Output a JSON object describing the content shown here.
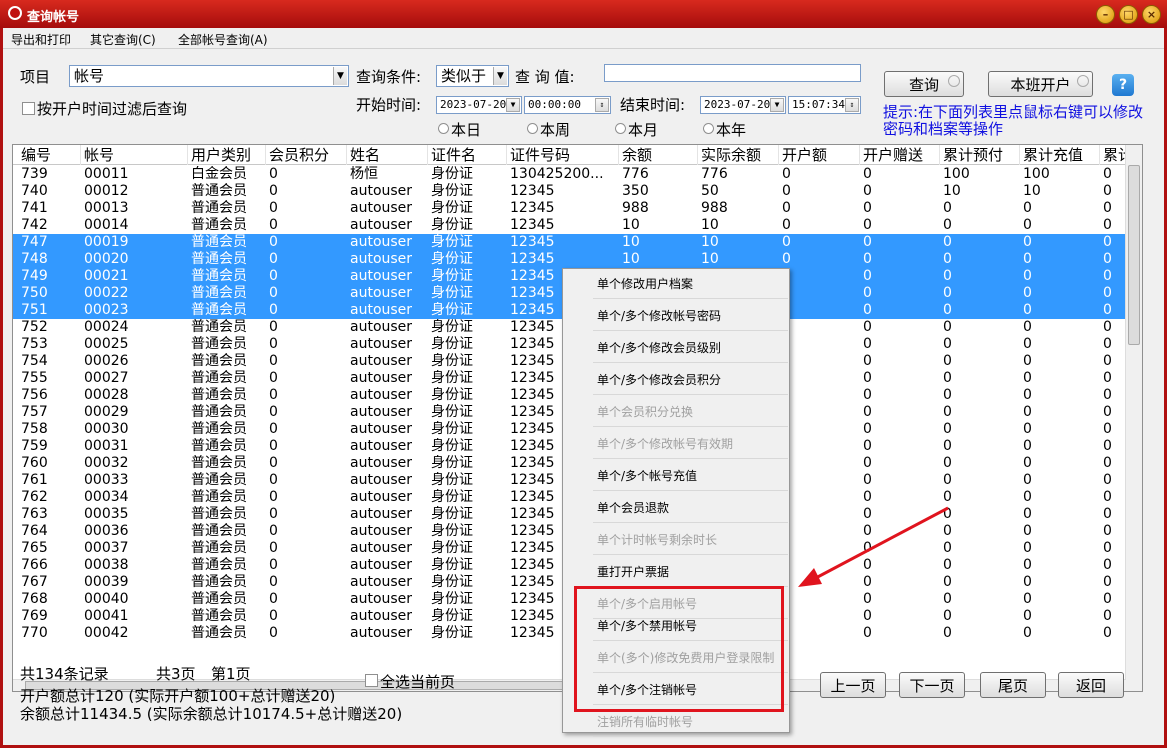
{
  "window": {
    "title": "查询帐号"
  },
  "menu": [
    "导出和打印",
    "其它查询(C)",
    "全部帐号查询(A)"
  ],
  "form": {
    "item_label": "项目",
    "item_value": "帐号",
    "condition_label": "查询条件:",
    "condition_value": "类似于",
    "query_value_label": "查 询 值:",
    "query_value": "",
    "filter_by_time_label": "按开户时间过滤后查询",
    "start_label": "开始时间:",
    "start_date": "2023-07-20",
    "start_time": "00:00:00",
    "end_label": "结束时间:",
    "end_date": "2023-07-20",
    "end_time": "15:07:34",
    "range_options": [
      "本日",
      "本周",
      "本月",
      "本年"
    ],
    "query_button": "查询",
    "shift_open_button": "本班开户",
    "hint": "提示:在下面列表里点鼠标右键可以修改密码和档案等操作"
  },
  "table": {
    "columns": [
      "编号",
      "帐号",
      "用户类别",
      "会员积分",
      "姓名",
      "证件名",
      "证件号码",
      "余额",
      "实际余额",
      "开户额",
      "开户赠送",
      "累计预付",
      "累计充值",
      "累计"
    ],
    "rows": [
      {
        "cells": [
          "739",
          "00011",
          "白金会员",
          "0",
          "杨恒",
          "身份证",
          "130425200...",
          "776",
          "776",
          "0",
          "0",
          "100",
          "100",
          "0"
        ],
        "selected": false
      },
      {
        "cells": [
          "740",
          "00012",
          "普通会员",
          "0",
          "autouser",
          "身份证",
          "12345",
          "350",
          "50",
          "0",
          "0",
          "10",
          "10",
          "0"
        ],
        "selected": false
      },
      {
        "cells": [
          "741",
          "00013",
          "普通会员",
          "0",
          "autouser",
          "身份证",
          "12345",
          "988",
          "988",
          "0",
          "0",
          "0",
          "0",
          "0"
        ],
        "selected": false
      },
      {
        "cells": [
          "742",
          "00014",
          "普通会员",
          "0",
          "autouser",
          "身份证",
          "12345",
          "10",
          "10",
          "0",
          "0",
          "0",
          "0",
          "0"
        ],
        "selected": false
      },
      {
        "cells": [
          "747",
          "00019",
          "普通会员",
          "0",
          "autouser",
          "身份证",
          "12345",
          "10",
          "10",
          "0",
          "0",
          "0",
          "0",
          "0"
        ],
        "selected": true
      },
      {
        "cells": [
          "748",
          "00020",
          "普通会员",
          "0",
          "autouser",
          "身份证",
          "12345",
          "10",
          "10",
          "0",
          "0",
          "0",
          "0",
          "0"
        ],
        "selected": true
      },
      {
        "cells": [
          "749",
          "00021",
          "普通会员",
          "0",
          "autouser",
          "身份证",
          "12345",
          "",
          "",
          "",
          "0",
          "0",
          "0",
          "0"
        ],
        "selected": true
      },
      {
        "cells": [
          "750",
          "00022",
          "普通会员",
          "0",
          "autouser",
          "身份证",
          "12345",
          "",
          "",
          "",
          "0",
          "0",
          "0",
          "0"
        ],
        "selected": true
      },
      {
        "cells": [
          "751",
          "00023",
          "普通会员",
          "0",
          "autouser",
          "身份证",
          "12345",
          "",
          "",
          "",
          "0",
          "0",
          "0",
          "0"
        ],
        "selected": true
      },
      {
        "cells": [
          "752",
          "00024",
          "普通会员",
          "0",
          "autouser",
          "身份证",
          "12345",
          "",
          "",
          "",
          "0",
          "0",
          "0",
          "0"
        ],
        "selected": false
      },
      {
        "cells": [
          "753",
          "00025",
          "普通会员",
          "0",
          "autouser",
          "身份证",
          "12345",
          "",
          "",
          "",
          "0",
          "0",
          "0",
          "0"
        ],
        "selected": false
      },
      {
        "cells": [
          "754",
          "00026",
          "普通会员",
          "0",
          "autouser",
          "身份证",
          "12345",
          "",
          "",
          "",
          "0",
          "0",
          "0",
          "0"
        ],
        "selected": false
      },
      {
        "cells": [
          "755",
          "00027",
          "普通会员",
          "0",
          "autouser",
          "身份证",
          "12345",
          "",
          "",
          "",
          "0",
          "0",
          "0",
          "0"
        ],
        "selected": false
      },
      {
        "cells": [
          "756",
          "00028",
          "普通会员",
          "0",
          "autouser",
          "身份证",
          "12345",
          "",
          "",
          "",
          "0",
          "0",
          "0",
          "0"
        ],
        "selected": false
      },
      {
        "cells": [
          "757",
          "00029",
          "普通会员",
          "0",
          "autouser",
          "身份证",
          "12345",
          "",
          "",
          "",
          "0",
          "0",
          "0",
          "0"
        ],
        "selected": false
      },
      {
        "cells": [
          "758",
          "00030",
          "普通会员",
          "0",
          "autouser",
          "身份证",
          "12345",
          "",
          "",
          "",
          "0",
          "0",
          "0",
          "0"
        ],
        "selected": false
      },
      {
        "cells": [
          "759",
          "00031",
          "普通会员",
          "0",
          "autouser",
          "身份证",
          "12345",
          "",
          "",
          "",
          "0",
          "0",
          "0",
          "0"
        ],
        "selected": false
      },
      {
        "cells": [
          "760",
          "00032",
          "普通会员",
          "0",
          "autouser",
          "身份证",
          "12345",
          "",
          "",
          "",
          "0",
          "0",
          "0",
          "0"
        ],
        "selected": false
      },
      {
        "cells": [
          "761",
          "00033",
          "普通会员",
          "0",
          "autouser",
          "身份证",
          "12345",
          "",
          "",
          "",
          "0",
          "0",
          "0",
          "0"
        ],
        "selected": false
      },
      {
        "cells": [
          "762",
          "00034",
          "普通会员",
          "0",
          "autouser",
          "身份证",
          "12345",
          "",
          "",
          "",
          "0",
          "0",
          "0",
          "0"
        ],
        "selected": false
      },
      {
        "cells": [
          "763",
          "00035",
          "普通会员",
          "0",
          "autouser",
          "身份证",
          "12345",
          "",
          "",
          "",
          "0",
          "0",
          "0",
          "0"
        ],
        "selected": false
      },
      {
        "cells": [
          "764",
          "00036",
          "普通会员",
          "0",
          "autouser",
          "身份证",
          "12345",
          "",
          "",
          "",
          "0",
          "0",
          "0",
          "0"
        ],
        "selected": false
      },
      {
        "cells": [
          "765",
          "00037",
          "普通会员",
          "0",
          "autouser",
          "身份证",
          "12345",
          "",
          "",
          "",
          "0",
          "0",
          "0",
          "0"
        ],
        "selected": false
      },
      {
        "cells": [
          "766",
          "00038",
          "普通会员",
          "0",
          "autouser",
          "身份证",
          "12345",
          "",
          "",
          "",
          "0",
          "0",
          "0",
          "0"
        ],
        "selected": false
      },
      {
        "cells": [
          "767",
          "00039",
          "普通会员",
          "0",
          "autouser",
          "身份证",
          "12345",
          "",
          "",
          "",
          "0",
          "0",
          "0",
          "0"
        ],
        "selected": false
      },
      {
        "cells": [
          "768",
          "00040",
          "普通会员",
          "0",
          "autouser",
          "身份证",
          "12345",
          "",
          "",
          "",
          "0",
          "0",
          "0",
          "0"
        ],
        "selected": false
      },
      {
        "cells": [
          "769",
          "00041",
          "普通会员",
          "0",
          "autouser",
          "身份证",
          "12345",
          "",
          "",
          "",
          "0",
          "0",
          "0",
          "0"
        ],
        "selected": false
      },
      {
        "cells": [
          "770",
          "00042",
          "普通会员",
          "0",
          "autouser",
          "身份证",
          "12345",
          "",
          "",
          "",
          "0",
          "0",
          "0",
          "0"
        ],
        "selected": false
      }
    ]
  },
  "context_menu": {
    "items": [
      {
        "label": "单个修改用户档案",
        "enabled": true
      },
      {
        "label": "单个/多个修改帐号密码",
        "enabled": true
      },
      {
        "label": "单个/多个修改会员级别",
        "enabled": true
      },
      {
        "label": "单个/多个修改会员积分",
        "enabled": true
      },
      {
        "label": "单个会员积分兑换",
        "enabled": false
      },
      {
        "label": "单个/多个修改帐号有效期",
        "enabled": false
      },
      {
        "label": "单个/多个帐号充值",
        "enabled": true
      },
      {
        "label": "单个会员退款",
        "enabled": true
      },
      {
        "label": "单个计时帐号剩余时长",
        "enabled": false
      },
      {
        "label": "重打开户票据",
        "enabled": true
      },
      {
        "label": "单个/多个启用帐号",
        "enabled": false
      },
      {
        "label": "单个/多个禁用帐号",
        "enabled": true
      },
      {
        "label": "单个(多个)修改免费用户登录限制",
        "enabled": false
      },
      {
        "label": "单个/多个注销帐号",
        "enabled": true
      },
      {
        "label": "注销所有临时帐号",
        "enabled": false
      }
    ]
  },
  "footer": {
    "total_records": "共134条记录",
    "total_pages": "共3页",
    "current_page": "第1页",
    "select_all_label": "全选当前页",
    "open_amount_summary": "开户额总计120 (实际开户额100+总计赠送20)",
    "balance_summary": "余额总计11434.5 (实际余额总计10174.5+总计赠送20)",
    "prev_button": "上一页",
    "next_button": "下一页",
    "last_button": "尾页",
    "back_button": "返回"
  },
  "colors": {
    "titlebar": "#c41a14",
    "selection": "#3399ff",
    "hint_text": "#1010e0",
    "annotation_red": "#e0141e"
  }
}
